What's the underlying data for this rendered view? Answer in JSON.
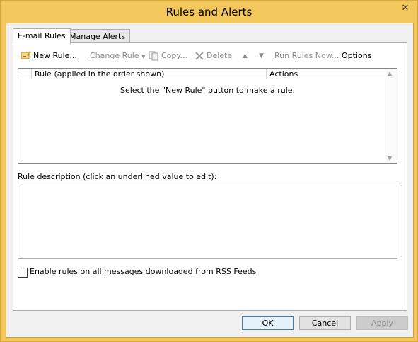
{
  "window": {
    "title": "Rules and Alerts",
    "close_glyph": "✕"
  },
  "tabs": [
    {
      "label": "E-mail Rules",
      "active": true
    },
    {
      "label": "Manage Alerts",
      "active": false
    }
  ],
  "toolbar": {
    "new_rule": "New Rule...",
    "change_rule": "Change Rule",
    "copy": "Copy...",
    "delete": "Delete",
    "run_rules": "Run Rules Now...",
    "options": "Options"
  },
  "rules_list": {
    "columns": [
      "Rule (applied in the order shown)",
      "Actions"
    ],
    "empty_message": "Select the \"New Rule\" button to make a rule."
  },
  "description": {
    "label": "Rule description (click an underlined value to edit):"
  },
  "rss_checkbox": {
    "label": "Enable rules on all messages downloaded from RSS Feeds",
    "checked": false
  },
  "buttons": {
    "ok": "OK",
    "cancel": "Cancel",
    "apply": "Apply"
  },
  "colors": {
    "frame": "#f2c75c",
    "default_button_border": "#3c7fb1"
  },
  "icons": [
    "new-rule-icon",
    "copy-icon",
    "delete-icon",
    "move-up-icon",
    "move-down-icon",
    "chevron-down-icon",
    "close-icon"
  ]
}
